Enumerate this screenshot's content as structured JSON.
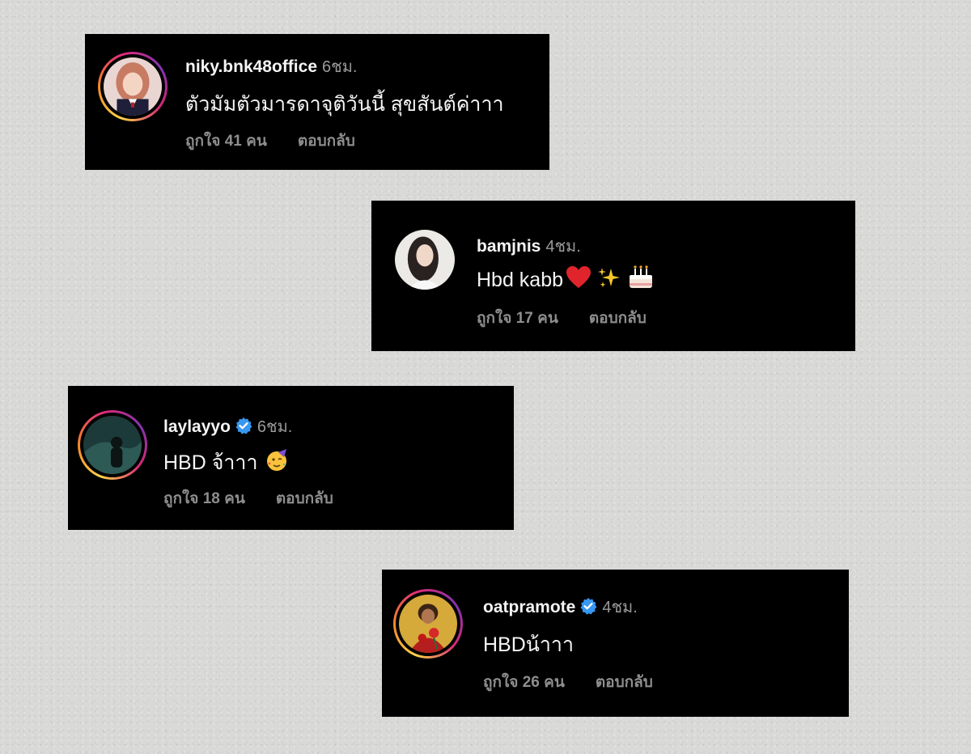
{
  "comments": [
    {
      "username": "niky.bnk48office",
      "verified": false,
      "time": "6ชม.",
      "text": "ตัวมัมตัวมารดาจุติวันนี้ สุขสันต์ค่าาา",
      "likes": "ถูกใจ 41 คน",
      "reply": "ตอบกลับ",
      "avatar_icon": "avatar-girl-idol-photo"
    },
    {
      "username": "bamjnis",
      "verified": false,
      "time": "4ชม.",
      "text": "Hbd kabb",
      "emojis": [
        "red-heart-emoji",
        "sparkles-emoji",
        "birthday-cake-emoji"
      ],
      "likes": "ถูกใจ 17 คน",
      "reply": "ตอบกลับ",
      "avatar_icon": "avatar-girl-portrait-photo"
    },
    {
      "username": "laylayyo",
      "verified": true,
      "time": "6ชม.",
      "text": "HBD จ้าาา",
      "emojis": [
        "partying-face-emoji"
      ],
      "likes": "ถูกใจ 18 คน",
      "reply": "ตอบกลับ",
      "avatar_icon": "avatar-silhouette-photo"
    },
    {
      "username": "oatpramote",
      "verified": true,
      "time": "4ชม.",
      "text": "HBDน้าาา",
      "likes": "ถูกใจ 26 คน",
      "reply": "ตอบกลับ",
      "avatar_icon": "avatar-man-with-roses-photo"
    }
  ],
  "colors": {
    "card_bg": "#000000",
    "username": "#f5f5f5",
    "meta_gray": "#8e8e8e",
    "verified_blue": "#3897f0",
    "page_bg": "#d9d9d7"
  }
}
